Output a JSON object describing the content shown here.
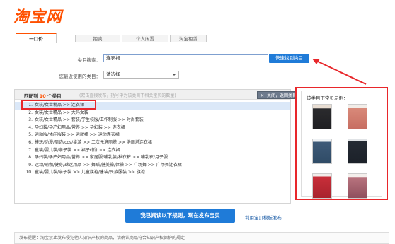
{
  "logo": "淘宝网",
  "tabs": [
    {
      "label": "一口价",
      "active": true
    },
    {
      "label": "拍卖",
      "active": false
    },
    {
      "label": "个人闲置",
      "active": false
    },
    {
      "label": "淘宝租赁",
      "active": false
    }
  ],
  "category_search": {
    "label": "类目搜索：",
    "value": "连衣裙",
    "button": "快速找到类目"
  },
  "recent": {
    "label": "您最近使用的类目：",
    "value": "请选择"
  },
  "results": {
    "found_prefix": "匹配到",
    "count": "10",
    "found_suffix": "个类目",
    "hint": "(双击直接发布，括号中为该类目下相关宝贝的数量)",
    "close": "关闭，返回类目",
    "items": [
      {
        "index": "1.",
        "text": "女装/女士精品 >> 连衣裙",
        "selected": true
      },
      {
        "index": "2.",
        "text": "女装/女士精品 >> 大码女装",
        "selected": false
      },
      {
        "index": "3.",
        "text": "女装/女士精品 >> 套装/学生校服/工作制服 >> 时尚套装",
        "selected": false
      },
      {
        "index": "4.",
        "text": "孕妇装/孕产妇用品/营养 >> 孕妇装 >> 连衣裙",
        "selected": false
      },
      {
        "index": "5.",
        "text": "运动服/休闲服装 >> 运动裙 >> 运动连衣裙",
        "selected": false
      },
      {
        "index": "6.",
        "text": "模玩/动漫/周边/cos/桌游 >> 二次元洛丽塔 >> 洛丽塔连衣裙",
        "selected": false
      },
      {
        "index": "7.",
        "text": "童装/婴儿装/亲子装 >> 裙子(新) >> 连衣裙",
        "selected": false
      },
      {
        "index": "8.",
        "text": "孕妇装/孕产妇用品/营养 >> 家居服/哺乳装/秋衣裤 >> 哺乳衣/月子服",
        "selected": false
      },
      {
        "index": "9.",
        "text": "运动/瑜伽/健身/球迷用品 >> 舞蹈/健美操/体操 >> 广场舞 >> 广场舞连衣裙",
        "selected": false
      },
      {
        "index": "10.",
        "text": "童装/婴儿装/亲子装 >> 儿童旗袍/唐装/民族服装 >> 旗袍",
        "selected": false
      }
    ]
  },
  "samples": {
    "title": "该类目下宝贝示例："
  },
  "publish_button": "我已阅读以下规则，现在发布宝贝",
  "template_link": "利用宝贝模板发布",
  "bottom_note": "发布提醒：淘宝禁止发布侵犯他人知识产权的商品，请确认商品符合知识产权保护的规定",
  "colors": {
    "brand": "#ff5000",
    "primary_button": "#1f7bd8",
    "annotation_red": "#e8272b"
  }
}
